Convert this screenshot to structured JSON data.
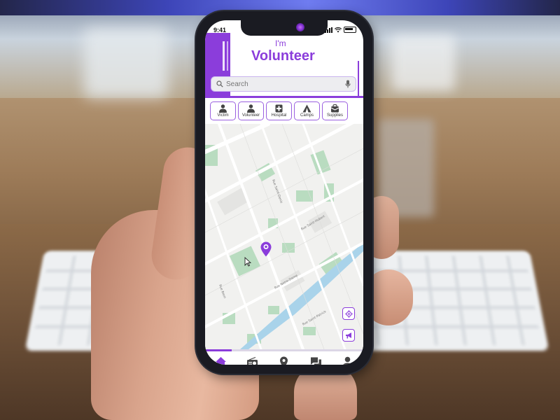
{
  "status_bar": {
    "time": "9:41"
  },
  "header": {
    "prefix": "I'm",
    "role": "Volunteer",
    "accent_color": "#8b3ddb"
  },
  "search": {
    "placeholder": "Search",
    "value": ""
  },
  "categories": [
    {
      "label": "Victim",
      "icon": "person-icon"
    },
    {
      "label": "Volunteer",
      "icon": "person-icon"
    },
    {
      "label": "Hospital",
      "icon": "hospital-cross-icon"
    },
    {
      "label": "Camps",
      "icon": "tent-icon"
    },
    {
      "label": "Supplies",
      "icon": "supplies-bag-icon"
    }
  ],
  "map": {
    "street_labels": [
      "Rue Saint-Denis",
      "Rue Saint-Hubert",
      "Rue Berri",
      "Rue Saint-Patrick",
      "Rue Notre-Dame"
    ],
    "buttons": {
      "locate": "locate-icon",
      "alert": "megaphone-icon"
    }
  },
  "bottom_nav": [
    {
      "name": "home",
      "icon": "home-icon",
      "active": true
    },
    {
      "name": "radio",
      "icon": "radio-icon",
      "active": false
    },
    {
      "name": "location",
      "icon": "map-pin-icon",
      "active": false
    },
    {
      "name": "chat",
      "icon": "chat-icon",
      "active": false
    },
    {
      "name": "profile",
      "icon": "profile-icon",
      "active": false
    }
  ]
}
